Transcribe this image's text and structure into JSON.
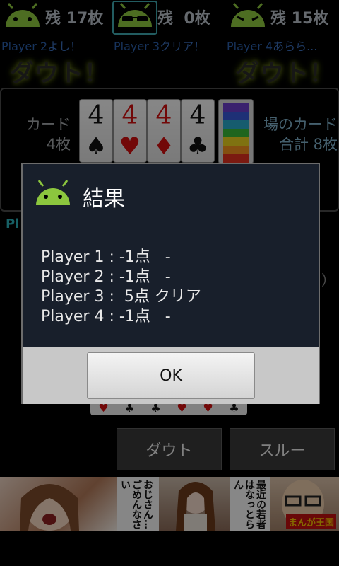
{
  "players_top": [
    {
      "count_text": "残 17枚",
      "message_name": "Player 2",
      "message_text": "よし！"
    },
    {
      "count_text": "残  0枚",
      "message_name": "Player 3",
      "message_text": "クリア！"
    },
    {
      "count_text": "残 15枚",
      "message_name": "Player 4",
      "message_text": "あらら..."
    }
  ],
  "shouts": {
    "left": "ダウト！",
    "right": "ダウト！"
  },
  "board": {
    "cards_label_line1": "カード",
    "cards_label_line2": "4枚",
    "pile_label_line1": "場のカード",
    "pile_label_line2": "合計  8枚",
    "cards": [
      {
        "rank": "4",
        "suit": "♠",
        "color": "black"
      },
      {
        "rank": "4",
        "suit": "♥",
        "color": "red"
      },
      {
        "rank": "4",
        "suit": "♦",
        "color": "red"
      },
      {
        "rank": "4",
        "suit": "♣",
        "color": "black"
      }
    ],
    "deck_colors": [
      "#6a3cc8",
      "#3858d8",
      "#28a8c8",
      "#38b838",
      "#e8d020",
      "#f09020",
      "#e03020"
    ]
  },
  "background_fragments": {
    "player_prefix": "Pl",
    "paren": "）"
  },
  "hand_suits": [
    "♥",
    "♣",
    "♣",
    "♥",
    "♥",
    "♣"
  ],
  "buttons": {
    "doubt": "ダウト",
    "pass": "スルー"
  },
  "ad": {
    "bubble1": "おじさん…ごめんなさい",
    "bubble2": "最近の若者はなっとらん",
    "logo": "まんが王国"
  },
  "dialog": {
    "title": "結果",
    "lines": [
      "Player 1 : -1点   -",
      "Player 2 : -1点   -",
      "Player 3 :  5点 クリア",
      "Player 4 : -1点   -"
    ],
    "ok_label": "OK"
  }
}
